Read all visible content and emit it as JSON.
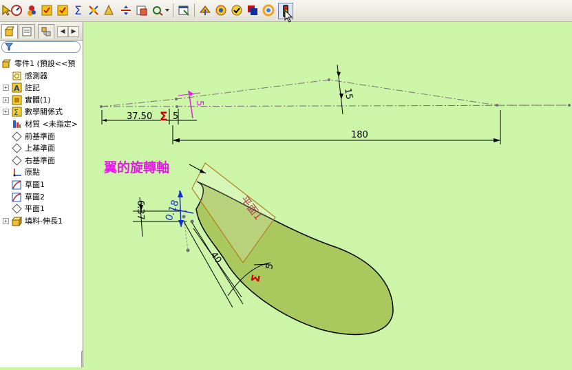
{
  "toolbar": {
    "buttons": [
      "select-icon",
      "sketch-icon",
      "smart-dimension-icon",
      "checkbox-icon",
      "checkbox-icon",
      "equation-sigma-icon",
      "measure-icon",
      "mass-properties-icon",
      "section-icon",
      "plane-icon",
      "options-icon",
      "toolbar-config-icon",
      "instant3d-icon",
      "rotate-icon",
      "check-icon",
      "appearance-icon",
      "color-icon",
      "traffic-light-icon"
    ]
  },
  "sidebar": {
    "tabs": [
      "feature-manager-tab",
      "property-manager-tab",
      "configuration-manager-tab"
    ],
    "tree": [
      {
        "label": "零件1 (預設<<預",
        "icon": "part-icon",
        "expand": "",
        "level": 0
      },
      {
        "label": "感測器",
        "icon": "sensor-icon",
        "expand": "",
        "level": 1
      },
      {
        "label": "註記",
        "icon": "annotation-icon",
        "expand": "+",
        "level": 1
      },
      {
        "label": "實體(1)",
        "icon": "solid-body-icon",
        "expand": "+",
        "level": 1
      },
      {
        "label": "數學關係式",
        "icon": "equation-icon",
        "expand": "+",
        "level": 1
      },
      {
        "label": "材質 <未指定>",
        "icon": "material-icon",
        "expand": "",
        "level": 1
      },
      {
        "label": "前基準面",
        "icon": "plane-icon",
        "expand": "",
        "level": 1
      },
      {
        "label": "上基準面",
        "icon": "plane-icon",
        "expand": "",
        "level": 1
      },
      {
        "label": "右基準面",
        "icon": "plane-icon",
        "expand": "",
        "level": 1
      },
      {
        "label": "原點",
        "icon": "origin-icon",
        "expand": "",
        "level": 1
      },
      {
        "label": "草圖1",
        "icon": "sketch-icon",
        "expand": "",
        "level": 1
      },
      {
        "label": "草圖2",
        "icon": "sketch-icon",
        "expand": "",
        "level": 1
      },
      {
        "label": "平面1",
        "icon": "plane-icon",
        "expand": "",
        "level": 1
      },
      {
        "label": "填料-伸長1",
        "icon": "extrude-icon",
        "expand": "+",
        "level": 1
      }
    ]
  },
  "canvas": {
    "dimensions": {
      "d_37_50": "37.50",
      "d_5_horizontal": "5",
      "d_5_pink": "5",
      "d_15": "15",
      "d_180": "180",
      "d_6_37": "6.37",
      "d_0_18": "0.18",
      "d_40": "40",
      "d_5_lower": "5"
    },
    "axis_label": "翼的旋轉軸",
    "plane_label": "平面1",
    "colors": {
      "background": "#ccf5a8",
      "blade_fill": "#a9c95f",
      "axis_label": "#e020e0",
      "plane_label": "#b04040",
      "sigma": "#cc0000"
    }
  }
}
